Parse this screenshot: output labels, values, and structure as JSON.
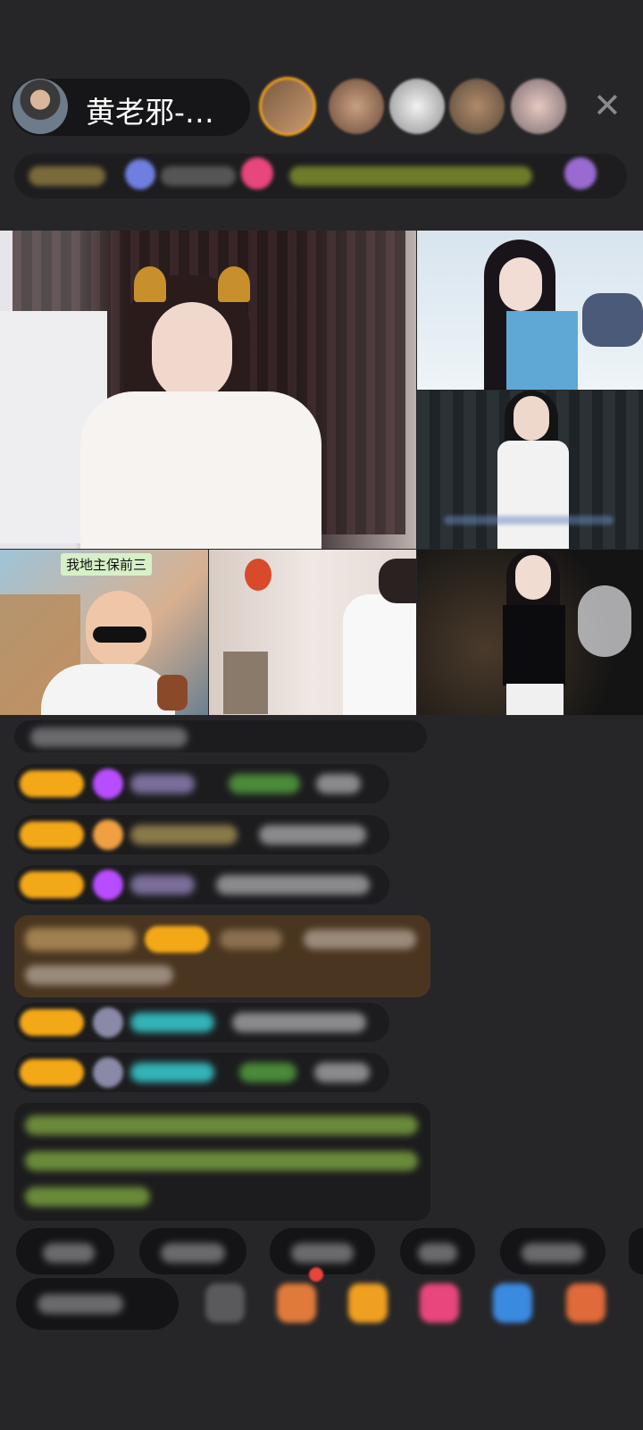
{
  "header": {
    "host_name": "黄老邪-…",
    "close_icon": "close-icon",
    "viewer_count": 5
  },
  "video_grid": {
    "tiles": [
      {
        "name": "main-stream",
        "caption": ""
      },
      {
        "name": "stream-2",
        "caption": ""
      },
      {
        "name": "stream-3",
        "caption": ""
      },
      {
        "name": "stream-4",
        "caption": "我地主保前三"
      },
      {
        "name": "stream-5",
        "caption": ""
      },
      {
        "name": "stream-6",
        "caption": ""
      }
    ]
  },
  "colors": {
    "background": "#262628",
    "badge_gold": "#f3a818",
    "accent_pink": "#e8467c",
    "accent_purple": "#b84dff",
    "teal_name": "#33b3b8",
    "green_text": "#9acd32"
  }
}
